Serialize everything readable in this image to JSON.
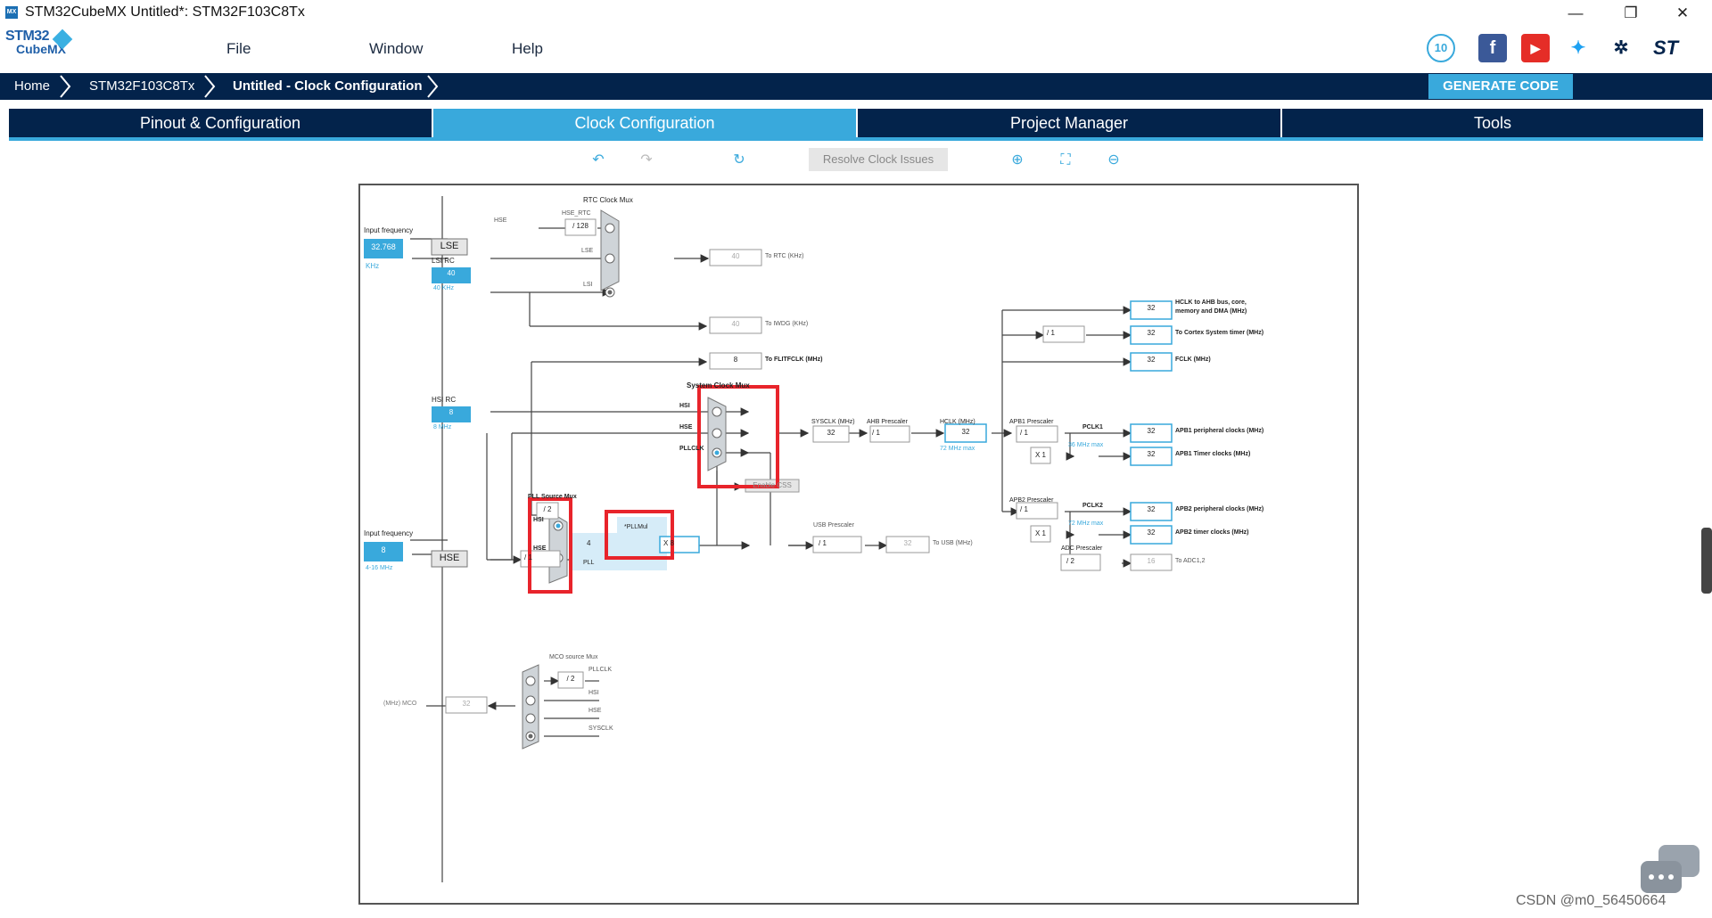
{
  "window": {
    "title": "STM32CubeMX Untitled*: STM32F103C8Tx",
    "icon_label": "MX",
    "controls": {
      "minimize": "—",
      "restore": "❐",
      "close": "✕"
    }
  },
  "logo": {
    "line1": "STM32",
    "line2": "CubeMX"
  },
  "menu": [
    "File",
    "Window",
    "Help"
  ],
  "social_icons": [
    "anniversary-10-icon",
    "facebook-icon",
    "youtube-icon",
    "twitter-icon",
    "network-icon",
    "st-logo-icon"
  ],
  "breadcrumb": [
    "Home",
    "STM32F103C8Tx",
    "Untitled - Clock Configuration"
  ],
  "generate_button": "GENERATE CODE",
  "tabs": [
    "Pinout & Configuration",
    "Clock Configuration",
    "Project Manager",
    "Tools"
  ],
  "active_tab": "Clock Configuration",
  "toolbar": {
    "resolve_label": "Resolve Clock Issues",
    "icons": [
      "undo-icon",
      "redo-icon",
      "refresh-icon",
      "zoom-in-icon",
      "fit-icon",
      "zoom-out-icon"
    ]
  },
  "diagram": {
    "lse": {
      "freq_label": "Input frequency",
      "value": "32.768",
      "unit": "KHz",
      "name": "LSE"
    },
    "lsi": {
      "name": "LSI RC",
      "value": "40",
      "unit": "40 KHz"
    },
    "hsi": {
      "name": "HSI RC",
      "value": "8",
      "unit": "8 MHz"
    },
    "hse": {
      "freq_label": "Input frequency",
      "value": "8",
      "unit": "4-16 MHz",
      "name": "HSE"
    },
    "rtc_mux": {
      "title": "RTC Clock Mux",
      "hse_label": "HSE",
      "div": "/ 128",
      "hse_rtc": "HSE_RTC",
      "lse": "LSE",
      "lsi": "LSI",
      "out_value": "40",
      "out_label": "To RTC (KHz)"
    },
    "iwdg": {
      "value": "40",
      "label": "To IWDG (KHz)"
    },
    "flitf": {
      "value": "8",
      "label": "To FLITFCLK (MHz)"
    },
    "sys_mux": {
      "title": "System Clock Mux",
      "hsi": "HSI",
      "hse": "HSE",
      "pllclk": "PLLCLK",
      "css": "Enable CSS"
    },
    "sysclk": {
      "label": "SYSCLK (MHz)",
      "value": "32"
    },
    "ahb": {
      "label": "AHB Prescaler",
      "value": "/ 1"
    },
    "hclk": {
      "label": "HCLK (MHz)",
      "value": "32",
      "max": "72 MHz max"
    },
    "apb1": {
      "label": "APB1 Prescaler",
      "value": "/ 1",
      "pclk": "PCLK1",
      "max": "36 MHz max",
      "mult": "X 1"
    },
    "apb2": {
      "label": "APB2 Prescaler",
      "value": "/ 1",
      "pclk": "PCLK2",
      "max": "72 MHz max",
      "mult": "X 1"
    },
    "adc": {
      "label": "ADC Prescaler",
      "value": "/ 2",
      "out": "16",
      "out_label": "To ADC1,2"
    },
    "cortex_div": "/ 1",
    "outputs": [
      {
        "value": "32",
        "label": "HCLK to AHB bus, core,",
        "label2": "memory and DMA (MHz)"
      },
      {
        "value": "32",
        "label": "To Cortex System timer (MHz)"
      },
      {
        "value": "32",
        "label": "FCLK (MHz)"
      },
      {
        "value": "32",
        "label": "APB1 peripheral clocks (MHz)"
      },
      {
        "value": "32",
        "label": "APB1 Timer clocks (MHz)"
      },
      {
        "value": "32",
        "label": "APB2 peripheral clocks (MHz)"
      },
      {
        "value": "32",
        "label": "APB2 timer clocks (MHz)"
      }
    ],
    "pll_mux": {
      "title": "PLL Source Mux",
      "hsi": "HSI",
      "hse": "HSE",
      "div2": "/ 2",
      "hse_div": "/ 1"
    },
    "pll": {
      "label": "PLL",
      "input": "4",
      "mul_label": "*PLLMul",
      "mul": "X 8"
    },
    "usb": {
      "label": "USB Prescaler",
      "value": "/ 1",
      "out": "32",
      "out_label": "To USB (MHz)"
    },
    "mco": {
      "title": "MCO source Mux",
      "div": "/ 2",
      "pllclk": "PLLCLK",
      "hsi": "HSI",
      "hse": "HSE",
      "sysclk": "SYSCLK",
      "out_label": "(MHz) MCO",
      "out_value": "32"
    }
  },
  "watermark": "CSDN @m0_56450664",
  "colors": {
    "navy": "#03234b",
    "accent": "#39a9dc",
    "highlight": "#e8242b",
    "pll_bg": "#d6ecf8"
  }
}
